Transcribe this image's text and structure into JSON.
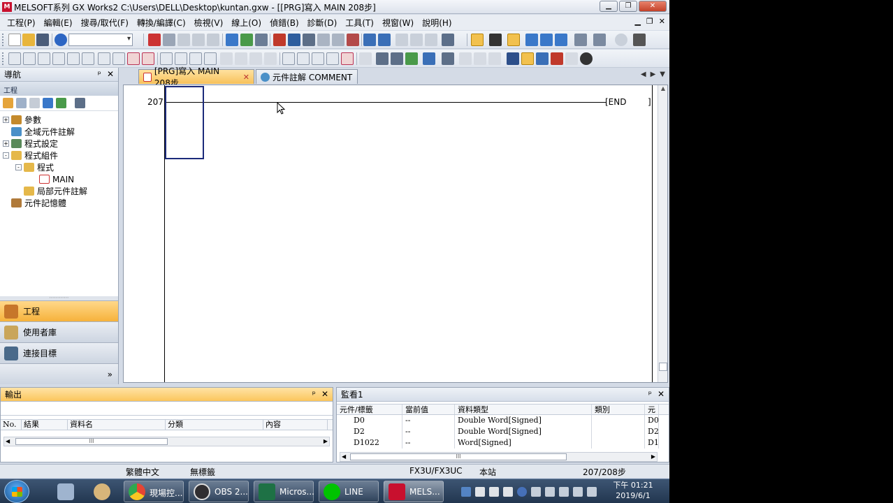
{
  "window": {
    "title": "MELSOFT系列 GX Works2 C:\\Users\\DELL\\Desktop\\kuntan.gxw - [[PRG]寫入 MAIN 208步]",
    "app_icon": "M"
  },
  "menu": [
    "工程(P)",
    "編輯(E)",
    "搜尋/取代(F)",
    "轉換/編譯(C)",
    "檢視(V)",
    "線上(O)",
    "偵錯(B)",
    "診斷(D)",
    "工具(T)",
    "視窗(W)",
    "說明(H)"
  ],
  "navigation": {
    "header": "導航",
    "section_title": "工程",
    "tree": [
      {
        "label": "參數",
        "level": 0,
        "expander": "+"
      },
      {
        "label": "全域元件註解",
        "level": 0,
        "expander": ""
      },
      {
        "label": "程式設定",
        "level": 0,
        "expander": "+"
      },
      {
        "label": "程式組件",
        "level": 0,
        "expander": "-"
      },
      {
        "label": "程式",
        "level": 1,
        "expander": "-"
      },
      {
        "label": "MAIN",
        "level": 2,
        "expander": ""
      },
      {
        "label": "局部元件註解",
        "level": 1,
        "expander": ""
      },
      {
        "label": "元件記憶體",
        "level": 0,
        "expander": ""
      }
    ],
    "buttons": [
      "工程",
      "使用者庫",
      "連接目標"
    ],
    "more": "»"
  },
  "tabs": [
    {
      "label": "[PRG]寫入 MAIN 208步",
      "active": true
    },
    {
      "label": "元件註解 COMMENT",
      "active": false
    }
  ],
  "ladder": {
    "step": "207",
    "end_instruction": "[END",
    "end_bracket": "]"
  },
  "output_pane": {
    "title": "輸出",
    "columns": [
      "No.",
      "結果",
      "資料名",
      "分類",
      "內容"
    ],
    "scroll_mark": "III"
  },
  "watch_pane": {
    "title": "監看1",
    "columns": [
      "元件/標籤",
      "當前值",
      "資料類型",
      "類別",
      "元"
    ],
    "rows": [
      {
        "device": "D0",
        "value": "--",
        "type": "Double Word[Signed]",
        "category": "",
        "extra": "D0"
      },
      {
        "device": "D2",
        "value": "--",
        "type": "Double Word[Signed]",
        "category": "",
        "extra": "D2"
      },
      {
        "device": "D1022",
        "value": "--",
        "type": "Word[Signed]",
        "category": "",
        "extra": "D1"
      }
    ],
    "scroll_mark": "III"
  },
  "statusbar": {
    "language": "繁體中文",
    "label": "無標籤",
    "cpu": "FX3U/FX3UC",
    "station": "本站",
    "steps": "207/208步"
  },
  "taskbar": {
    "tasks": [
      {
        "label": "現場控...",
        "icon": "chrome-icon",
        "color": "#e64534"
      },
      {
        "label": "OBS 2...",
        "icon": "obs-icon",
        "color": "#302e31"
      },
      {
        "label": "Micros...",
        "icon": "excel-icon",
        "color": "#1e7145"
      },
      {
        "label": "LINE",
        "icon": "line-icon",
        "color": "#00c300"
      },
      {
        "label": "MELS...",
        "icon": "melsoft-icon",
        "color": "#c8102e"
      }
    ],
    "clock_time": "下午 01:21",
    "clock_date": "2019/6/1"
  },
  "colors": {
    "active_tab": "#f7c15a",
    "selection_box": "#1c2b7a",
    "nav_active": "#f6b23b"
  }
}
